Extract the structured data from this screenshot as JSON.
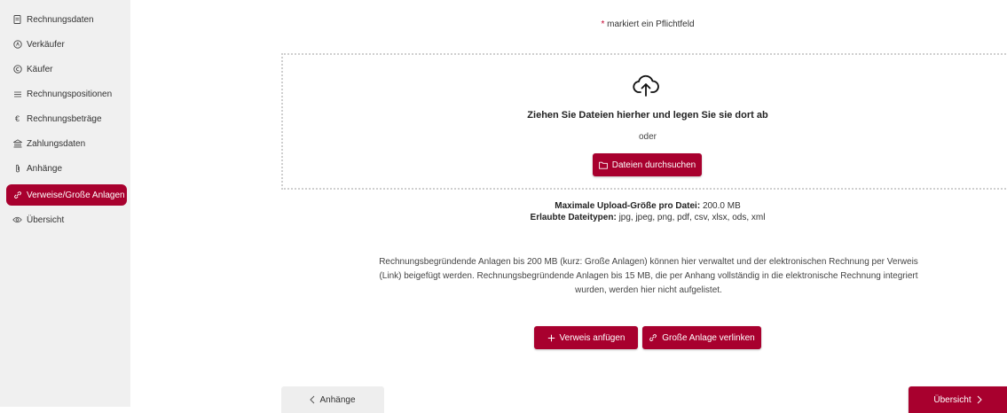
{
  "sidebar": {
    "items": [
      {
        "label": "Rechnungsdaten",
        "icon": "document-icon"
      },
      {
        "label": "Verkäufer",
        "icon": "seller-icon"
      },
      {
        "label": "Käufer",
        "icon": "buyer-icon"
      },
      {
        "label": "Rechnungspositionen",
        "icon": "list-icon"
      },
      {
        "label": "Rechnungsbeträge",
        "icon": "euro-icon"
      },
      {
        "label": "Zahlungsdaten",
        "icon": "bank-icon"
      },
      {
        "label": "Anhänge",
        "icon": "paperclip-icon"
      },
      {
        "label": "Verweise/Große Anlagen",
        "icon": "link-icon",
        "active": true
      },
      {
        "label": "Übersicht",
        "icon": "eye-icon"
      }
    ]
  },
  "form": {
    "required_star": "*",
    "required_text": "markiert ein Pflichtfeld"
  },
  "dropzone": {
    "title": "Ziehen Sie Dateien hierher und legen Sie sie dort ab",
    "or_text": "oder",
    "browse_label": "Dateien durchsuchen"
  },
  "limits": {
    "max_size_label": "Maximale Upload-Größe pro Datei:",
    "max_size_value": "200.0 MB",
    "types_label": "Erlaubte Dateitypen:",
    "types_value": "jpg, jpeg, png, pdf, csv, xlsx, ods, xml"
  },
  "description": {
    "line1": "Rechnungsbegründende Anlagen bis 200 MB (kurz: Große Anlagen) können hier verwaltet und der elektronischen Rechnung per Verweis",
    "line2": "(Link) beigefügt werden. Rechnungsbegründende Anlagen bis 15 MB, die per Anhang vollständig in die elektronische Rechnung integriert",
    "line3": "wurden, werden hier nicht aufgelistet."
  },
  "actions": {
    "add_reference": "Verweis anfügen",
    "link_attachment": "Große Anlage verlinken"
  },
  "footer": {
    "back_label": "Anhänge",
    "next_label": "Übersicht"
  },
  "colors": {
    "accent": "#a8002e",
    "sidebar_bg": "#f0f0f0",
    "required": "#c4002f"
  }
}
